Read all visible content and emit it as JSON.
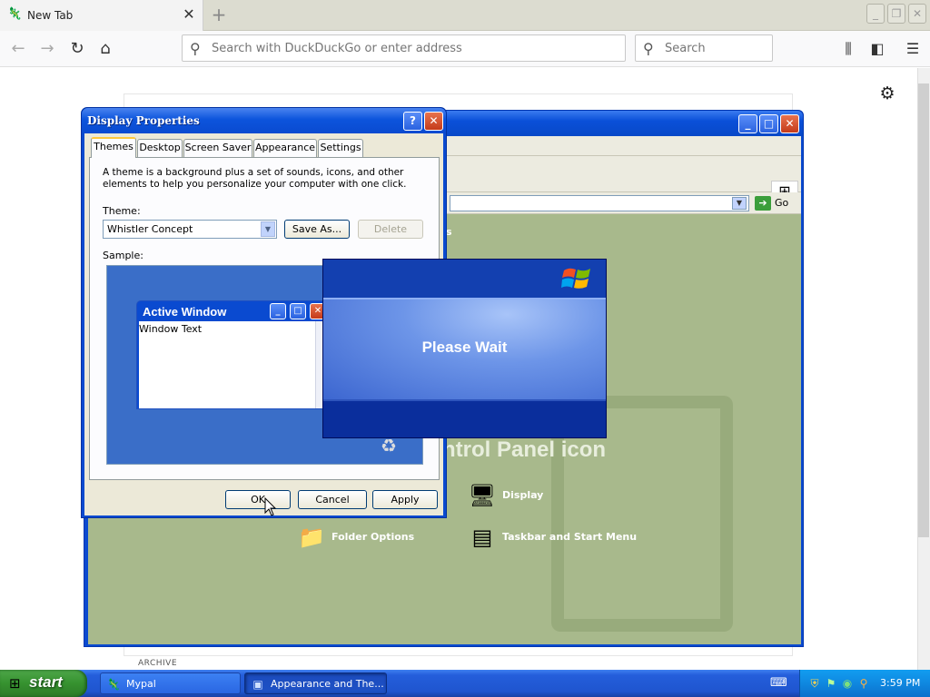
{
  "browser": {
    "tab_title": "New Tab",
    "url_placeholder": "Search with DuckDuckGo or enter address",
    "search_placeholder": "Search",
    "icons": {
      "tab": "tab-favicon",
      "close": "close-icon",
      "new_tab": "plus-icon",
      "back": "back-arrow-icon",
      "forward": "forward-arrow-icon",
      "reload": "reload-icon",
      "home": "home-icon",
      "library": "library-icon",
      "sidebar": "sidebar-icon",
      "menu": "hamburger-menu-icon",
      "settings": "gear-icon"
    }
  },
  "page": {
    "archive_label": "ARCHIVE"
  },
  "control_panel": {
    "go_label": "Go",
    "partial_text": "s",
    "heading_fragment": "ntrol Panel icon",
    "items": [
      {
        "label": "Display",
        "icon": "display-icon"
      },
      {
        "label": "Folder Options",
        "icon": "folder-options-icon"
      },
      {
        "label": "Taskbar and Start Menu",
        "icon": "taskbar-icon"
      }
    ]
  },
  "display_properties": {
    "title": "Display Properties",
    "help_btn": "?",
    "close_btn": "✕",
    "tabs": [
      "Themes",
      "Desktop",
      "Screen Saver",
      "Appearance",
      "Settings"
    ],
    "active_tab": "Themes",
    "description": "A theme is a background plus a set of sounds, icons, and other elements to help you personalize your computer with one click.",
    "theme_label": "Theme:",
    "theme_value": "Whistler Concept",
    "save_as": "Save As...",
    "delete": "Delete",
    "sample_label": "Sample:",
    "sample_window_title": "Active Window",
    "sample_window_text": "Window Text",
    "ok": "OK",
    "cancel": "Cancel",
    "apply": "Apply"
  },
  "please_wait": {
    "text": "Please Wait"
  },
  "taskbar": {
    "start_label": "start",
    "tasks": [
      {
        "label": "Mypal",
        "icon": "mypal-icon",
        "active": false
      },
      {
        "label": "Appearance and The...",
        "icon": "control-panel-icon",
        "active": true
      }
    ],
    "clock": "3:59 PM"
  },
  "colors": {
    "xp_blue": "#0a4ad0",
    "xp_green": "#36922f",
    "cp_background": "#a8b98c"
  }
}
